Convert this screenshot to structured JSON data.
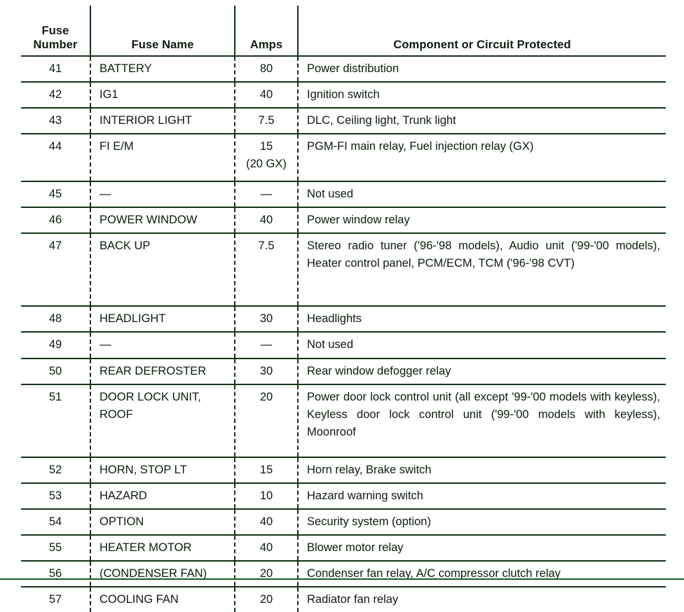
{
  "table": {
    "headers": {
      "fuse_number": "Fuse\nNumber",
      "fuse_number_line1": "Fuse",
      "fuse_number_line2": "Number",
      "fuse_name": "Fuse Name",
      "amps": "Amps",
      "component": "Component or Circuit Protected"
    },
    "colors": {
      "rule": "#16331a",
      "text": "#0d1c0d",
      "background": "#ffffff"
    },
    "rows": [
      {
        "number": "41",
        "name": "BATTERY",
        "amps": "80",
        "amps_note": "",
        "component": "Power distribution"
      },
      {
        "number": "42",
        "name": "IG1",
        "amps": "40",
        "amps_note": "",
        "component": "Ignition switch"
      },
      {
        "number": "43",
        "name": "INTERIOR LIGHT",
        "amps": "7.5",
        "amps_note": "",
        "component": "DLC, Ceiling light, Trunk light"
      },
      {
        "number": "44",
        "name": "FI E/M",
        "amps": "15",
        "amps_note": "(20 GX)",
        "component": "PGM-FI main relay, Fuel injection relay (GX)"
      },
      {
        "number": "45",
        "name": "—",
        "amps": "—",
        "amps_note": "",
        "component": "Not used"
      },
      {
        "number": "46",
        "name": "POWER WINDOW",
        "amps": "40",
        "amps_note": "",
        "component": "Power window relay"
      },
      {
        "number": "47",
        "name": "BACK UP",
        "amps": "7.5",
        "amps_note": "",
        "component": "Stereo radio tuner ('96-'98 models), Audio unit ('99-'00 models), Heater control panel, PCM/ECM, TCM ('96-'98 CVT)"
      },
      {
        "number": "48",
        "name": "HEADLIGHT",
        "amps": "30",
        "amps_note": "",
        "component": "Headlights"
      },
      {
        "number": "49",
        "name": "—",
        "amps": "—",
        "amps_note": "",
        "component": "Not used"
      },
      {
        "number": "50",
        "name": "REAR DEFROSTER",
        "amps": "30",
        "amps_note": "",
        "component": "Rear window defogger relay"
      },
      {
        "number": "51",
        "name": "DOOR LOCK UNIT, ROOF",
        "amps": "20",
        "amps_note": "",
        "component": "Power door lock control unit (all except '99-'00 models with keyless), Keyless door lock control unit ('99-'00 models with keyless), Moonroof"
      },
      {
        "number": "52",
        "name": "HORN, STOP LT",
        "amps": "15",
        "amps_note": "",
        "component": "Horn relay, Brake switch"
      },
      {
        "number": "53",
        "name": "HAZARD",
        "amps": "10",
        "amps_note": "",
        "component": "Hazard warning switch"
      },
      {
        "number": "54",
        "name": "OPTION",
        "amps": "40",
        "amps_note": "",
        "component": "Security system (option)"
      },
      {
        "number": "55",
        "name": "HEATER MOTOR",
        "amps": "40",
        "amps_note": "",
        "component": "Blower motor relay"
      },
      {
        "number": "56",
        "name": "(CONDENSER FAN)",
        "amps": "20",
        "amps_note": "",
        "component": "Condenser fan relay, A/C compressor clutch relay"
      },
      {
        "number": "57",
        "name": "COOLING FAN",
        "amps": "20",
        "amps_note": "",
        "component": "Radiator fan relay"
      }
    ]
  }
}
